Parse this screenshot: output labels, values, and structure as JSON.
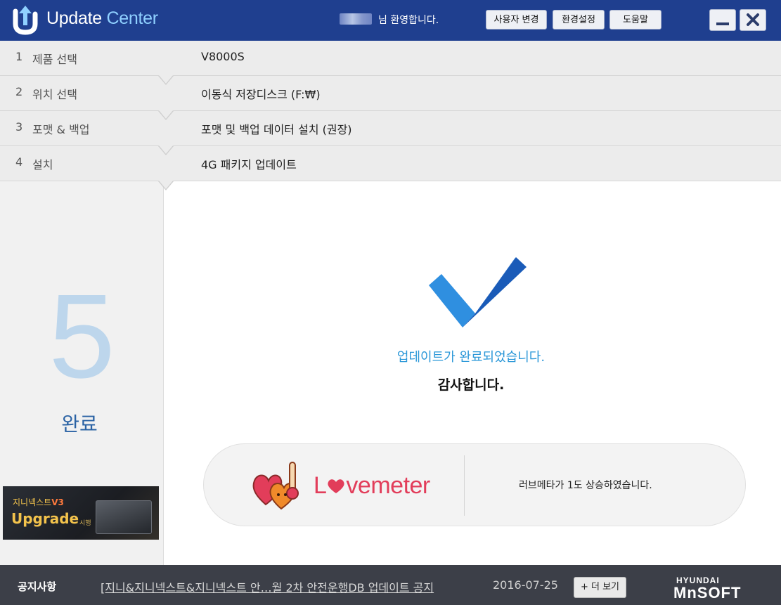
{
  "window": {
    "title_prefix": "Update",
    "title_suffix": "Center",
    "welcome_text": "님 환영합니다.",
    "buttons": {
      "change_user": "사용자 변경",
      "settings": "환경설정",
      "help": "도움말"
    },
    "icons": [
      "update-logo-icon",
      "minimize-icon",
      "close-icon"
    ]
  },
  "steps": [
    {
      "number": "1",
      "name": "제품 선택",
      "value": "V8000S"
    },
    {
      "number": "2",
      "name": "위치 선택",
      "value": "이동식 저장디스크 (F:₩)"
    },
    {
      "number": "3",
      "name": "포맷 & 백업",
      "value": "포맷 및 백업 데이터 설치 (권장)"
    },
    {
      "number": "4",
      "name": "설치",
      "value": "4G 패키지 업데이트"
    }
  ],
  "current_step": {
    "number": "5",
    "label": "완료"
  },
  "banner": {
    "line1": "지니넥스트",
    "version": "V3",
    "line2": "Upgrade",
    "line3": "시행"
  },
  "result": {
    "message": "업데이트가 완료되었습니다.",
    "thanks": "감사합니다.",
    "icon": "checkmark-icon"
  },
  "lovemeter": {
    "logo_l": "L",
    "logo_rest": "vemeter",
    "message": "러브메타가 1도 상승하였습니다."
  },
  "footer": {
    "notice_label": "공지사항",
    "notice_title": "[지니&지니넥스트&지니넥스트 안…월 2차 안전운행DB 업데이트 공지",
    "notice_date": "2016-07-25",
    "more_button": "+ 더 보기",
    "brand_top": "HYUNDAI",
    "brand_bottom": "MnSOFT"
  },
  "colors": {
    "titlebar": "#1f3f8f",
    "accent_blue": "#2a97d8",
    "step_bg": "#ececec",
    "footer_bg": "#3c3f48",
    "lovemeter_red": "#e23d5a"
  }
}
